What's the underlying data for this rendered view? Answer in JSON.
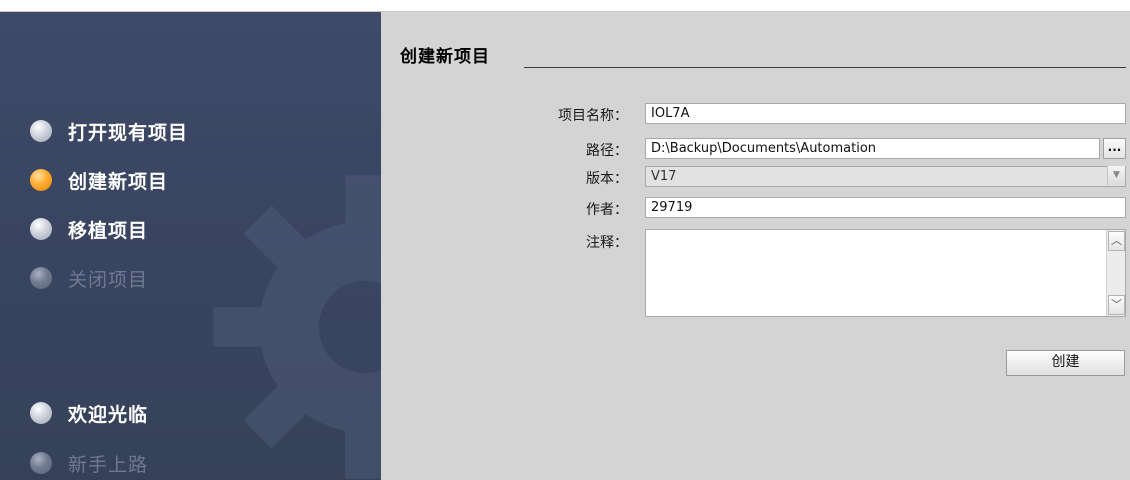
{
  "sidebar": {
    "items": [
      {
        "label": "打开现有项目"
      },
      {
        "label": "创建新项目"
      },
      {
        "label": "移植项目"
      },
      {
        "label": "关闭项目"
      },
      {
        "label": "欢迎光临"
      },
      {
        "label": "新手上路"
      }
    ],
    "active_item": "创建新项目",
    "background_color": "#3a4562",
    "active_dot_color": "#ffab2e"
  },
  "main": {
    "title": "创建新项目",
    "fields": {
      "project_name": {
        "label": "项目名称：",
        "value": "IOL7A"
      },
      "path": {
        "label": "路径：",
        "value": "D:\\Backup\\Documents\\Automation",
        "browse_label": "..."
      },
      "version": {
        "label": "版本：",
        "value": "V17"
      },
      "author": {
        "label": "作者：",
        "value": "29719"
      },
      "comment": {
        "label": "注释：",
        "value": ""
      }
    },
    "create_button": "创建",
    "background_color": "#d4d4d4"
  },
  "icons": {
    "browse": "ellipsis-icon",
    "dropdown": "chevron-down-icon",
    "scroll_up": "chevron-up-icon",
    "scroll_down": "chevron-down-icon",
    "nav_bullet": "circle-bullet-icon",
    "background_gear": "gear-icon"
  }
}
